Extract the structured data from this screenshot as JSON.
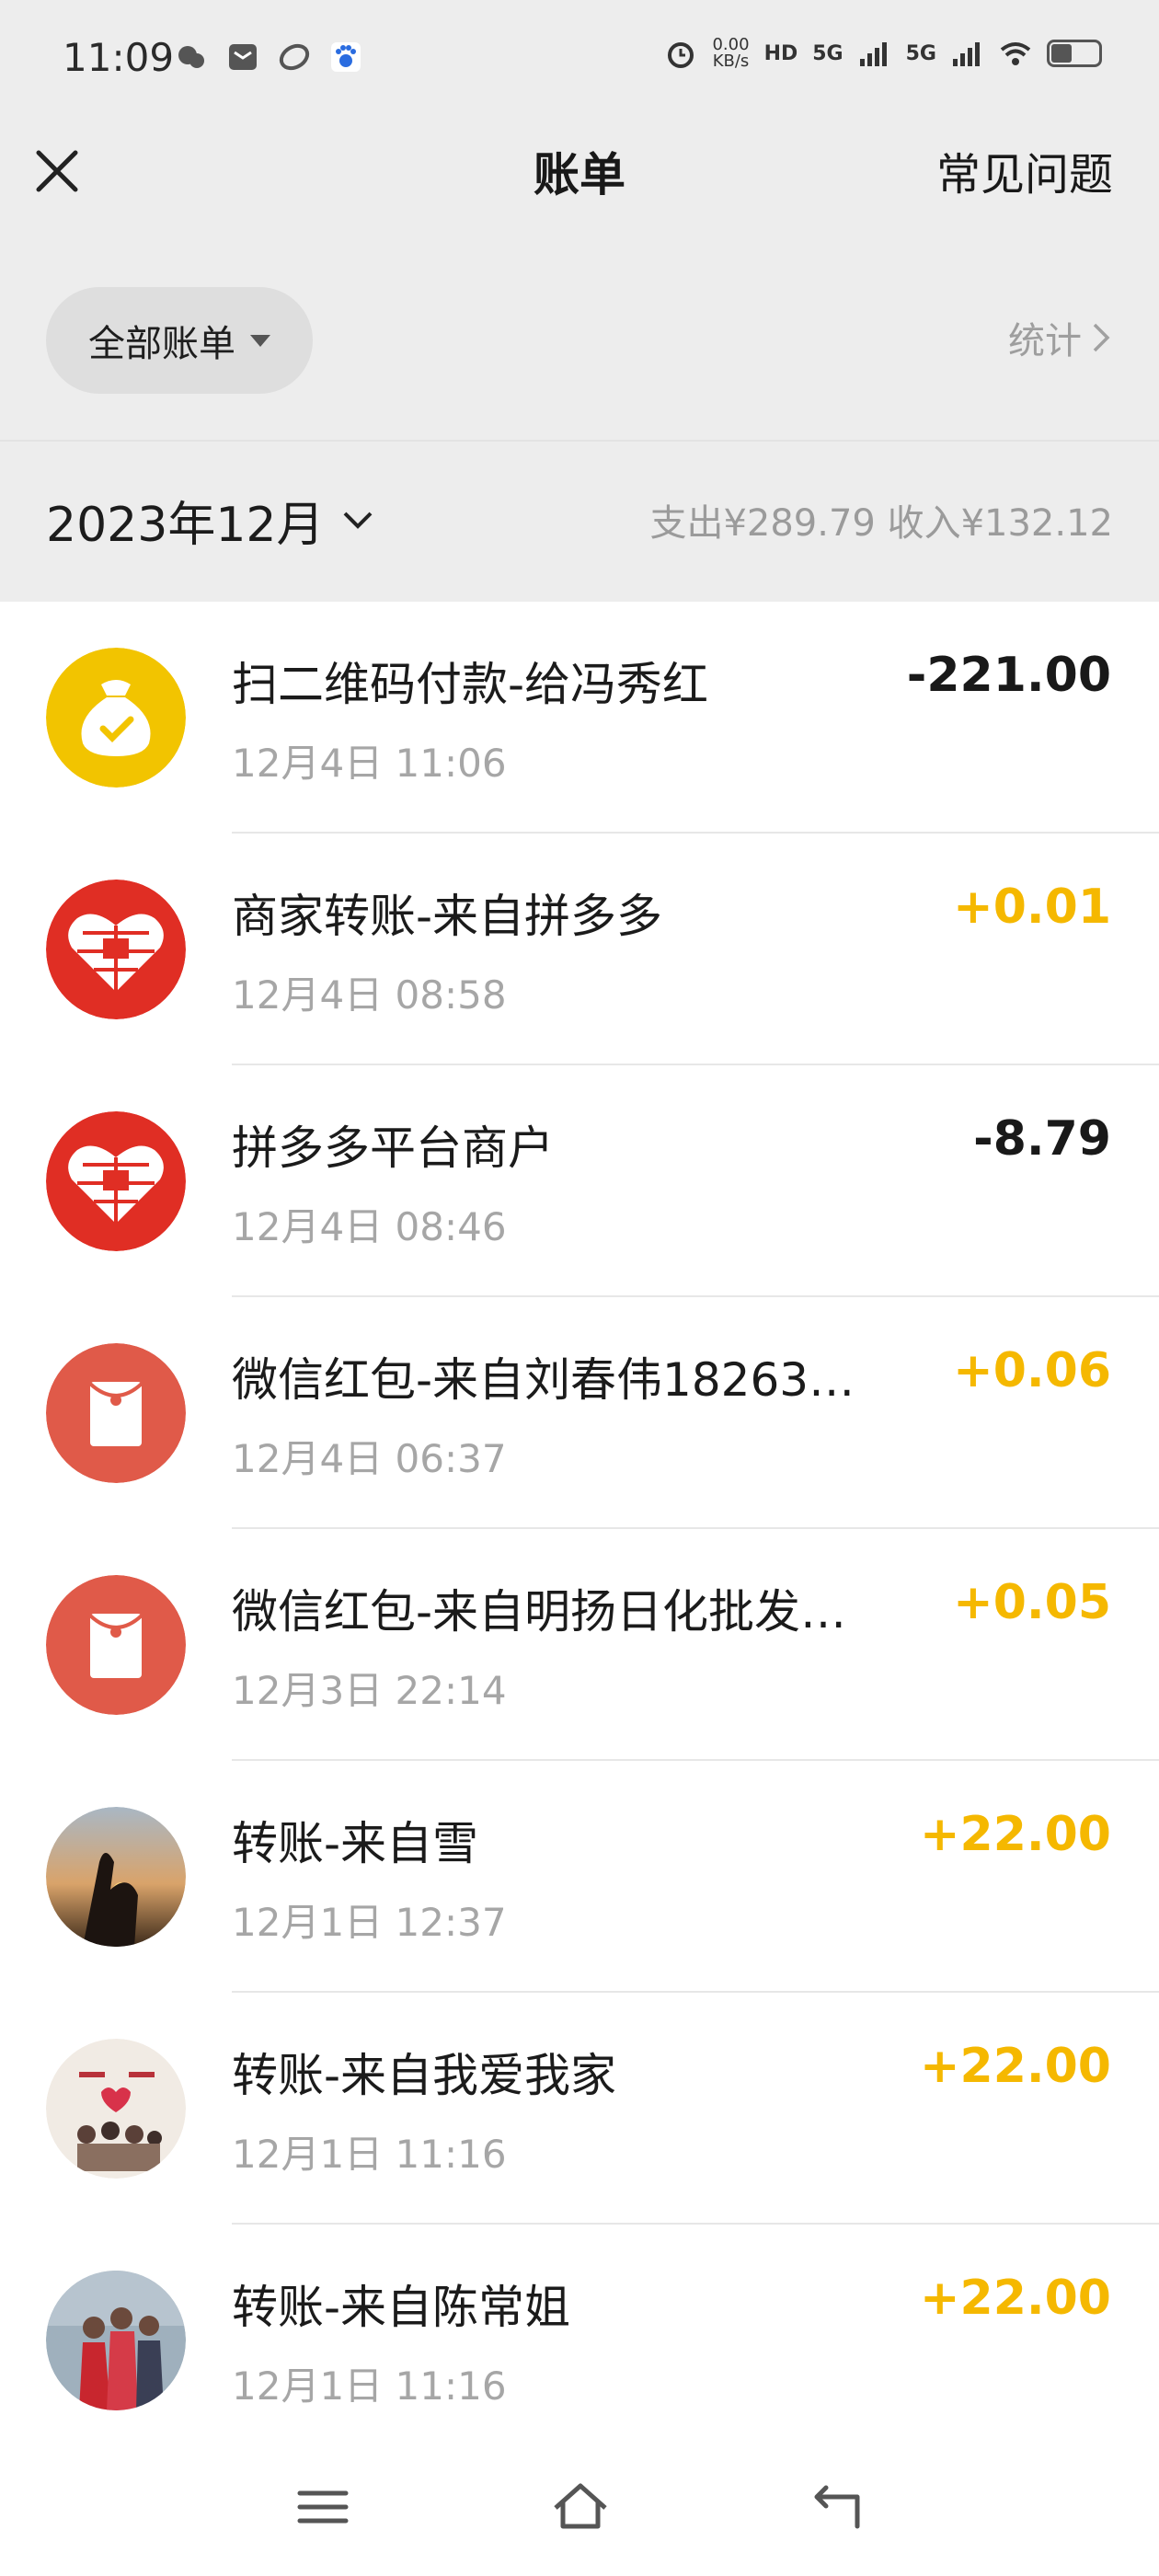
{
  "status": {
    "time": "11:09",
    "net_speed_value": "0.00",
    "net_speed_unit": "KB/s",
    "hd_label": "HD",
    "signal1": "5G",
    "signal2": "5G"
  },
  "nav": {
    "title": "账单",
    "faq_label": "常见问题"
  },
  "filter": {
    "label": "全部账单",
    "stats_label": "统计"
  },
  "month": {
    "label": "2023年12月",
    "summary": "支出¥289.79 收入¥132.12"
  },
  "transactions": [
    {
      "title": "扫二维码付款-给冯秀红",
      "time": "12月4日 11:06",
      "amount": "-221.00",
      "type": "out",
      "icon": "money-bag-icon"
    },
    {
      "title": "商家转账-来自拼多多",
      "time": "12月4日 08:58",
      "amount": "+0.01",
      "type": "in",
      "icon": "pinduoduo-logo"
    },
    {
      "title": "拼多多平台商户",
      "time": "12月4日 08:46",
      "amount": "-8.79",
      "type": "out",
      "icon": "pinduoduo-logo"
    },
    {
      "title": "微信红包-来自刘春伟18263…",
      "time": "12月4日 06:37",
      "amount": "+0.06",
      "type": "in",
      "icon": "red-envelope-icon"
    },
    {
      "title": "微信红包-来自明扬日化批发…",
      "time": "12月3日 22:14",
      "amount": "+0.05",
      "type": "in",
      "icon": "red-envelope-icon"
    },
    {
      "title": "转账-来自雪",
      "time": "12月1日 12:37",
      "amount": "+22.00",
      "type": "in",
      "icon": "avatar-photo"
    },
    {
      "title": "转账-来自我爱我家",
      "time": "12月1日 11:16",
      "amount": "+22.00",
      "type": "in",
      "icon": "avatar-photo"
    },
    {
      "title": "转账-来自陈常姐",
      "time": "12月1日 11:16",
      "amount": "+22.00",
      "type": "in",
      "icon": "avatar-photo"
    }
  ],
  "colors": {
    "income": "#f5b800",
    "expense": "#191919",
    "header_bg": "#ededed"
  }
}
